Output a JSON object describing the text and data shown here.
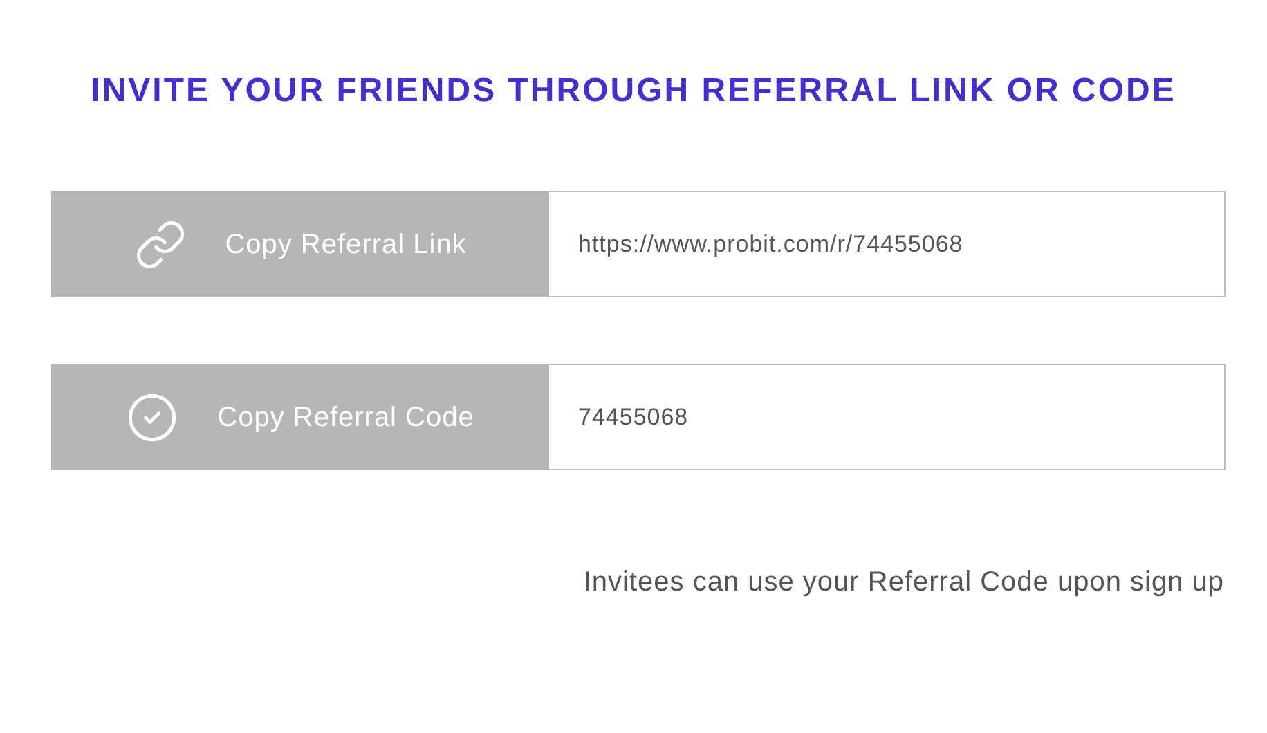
{
  "title": "INVITE YOUR FRIENDS THROUGH REFERRAL LINK OR CODE",
  "rows": [
    {
      "kind": "link",
      "button": "Copy Referral Link",
      "value": "https://www.probit.com/r/74455068"
    },
    {
      "kind": "code",
      "button": "Copy Referral Code",
      "value": "74455068"
    }
  ],
  "note": "Invitees can use your Referral Code upon sign up"
}
